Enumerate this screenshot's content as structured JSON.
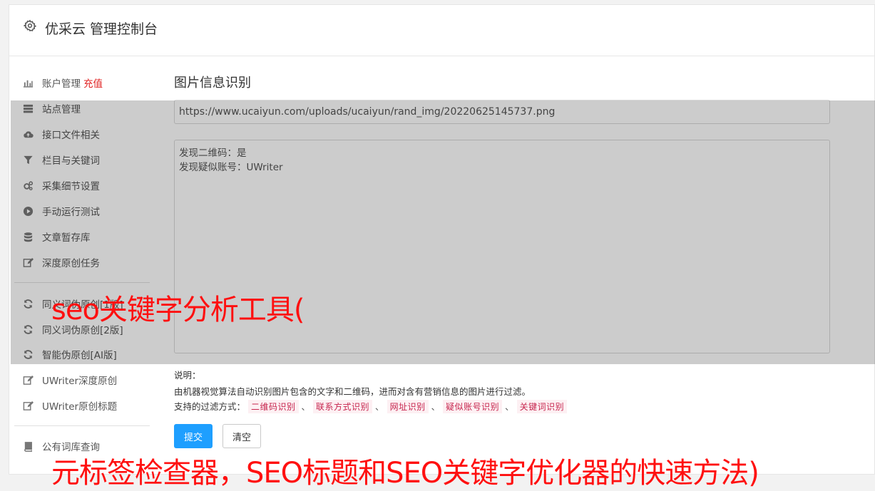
{
  "app": {
    "title": "优采云 管理控制台"
  },
  "sidebar": {
    "items": [
      {
        "label": "账户管理",
        "extra": "充值",
        "icon": "bar-chart-icon"
      },
      {
        "label": "站点管理",
        "icon": "server-icon"
      },
      {
        "label": "接口文件相关",
        "icon": "cloud-upload-icon"
      },
      {
        "label": "栏目与关键词",
        "icon": "filter-icon"
      },
      {
        "label": "采集细节设置",
        "icon": "gears-icon"
      },
      {
        "label": "手动运行测试",
        "icon": "play-circle-icon"
      },
      {
        "label": "文章暂存库",
        "icon": "database-icon"
      },
      {
        "label": "深度原创任务",
        "icon": "edit-icon"
      },
      {
        "label": "同义词伪原创[1版]",
        "icon": "refresh-icon"
      },
      {
        "label": "同义词伪原创[2版]",
        "icon": "refresh-icon"
      },
      {
        "label": "智能伪原创[AI版]",
        "icon": "refresh-icon"
      },
      {
        "label": "UWriter深度原创",
        "icon": "edit-icon"
      },
      {
        "label": "UWriter原创标题",
        "icon": "edit-icon"
      },
      {
        "label": "公有词库查询",
        "icon": "book-icon"
      }
    ]
  },
  "main": {
    "title": "图片信息识别",
    "url_value": "https://www.ucaiyun.com/uploads/ucaiyun/rand_img/20220625145737.png",
    "result_lines": [
      "发现二维码：是",
      "发现疑似账号：UWriter"
    ],
    "help_label": "说明：",
    "help_text": "由机器视觉算法自动识别图片包含的文字和二维码，进而对含有营销信息的图片进行过滤。",
    "filter_label": "支持的过滤方式：",
    "filter_tags": [
      "二维码识别",
      "联系方式识别",
      "网址识别",
      "疑似账号识别",
      "关键词识别"
    ],
    "separator": "、",
    "submit_label": "提交",
    "clear_label": "清空"
  },
  "watermark": {
    "line1": "seo关键字分析工具(",
    "line2": "元标签检查器，SEO标题和SEO关键字优化器的快速方法)"
  },
  "colors": {
    "accent": "#1e9fff",
    "red": "#e02020",
    "tag_text": "#c7254e",
    "watermark": "#ff1010"
  }
}
